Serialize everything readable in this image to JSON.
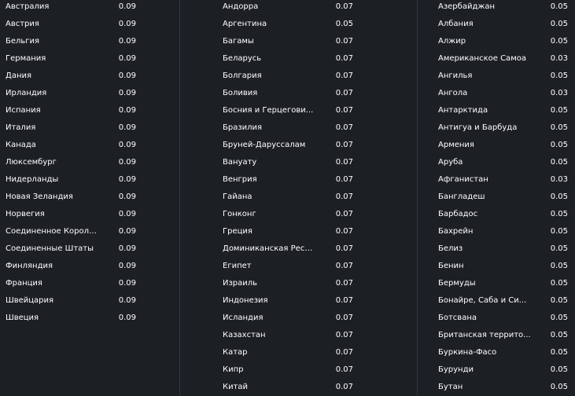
{
  "columns": [
    {
      "rows": [
        {
          "name": "Австралия",
          "value": "0.09"
        },
        {
          "name": "Австрия",
          "value": "0.09"
        },
        {
          "name": "Бельгия",
          "value": "0.09"
        },
        {
          "name": "Германия",
          "value": "0.09"
        },
        {
          "name": "Дания",
          "value": "0.09"
        },
        {
          "name": "Ирландия",
          "value": "0.09"
        },
        {
          "name": "Испания",
          "value": "0.09"
        },
        {
          "name": "Италия",
          "value": "0.09"
        },
        {
          "name": "Канада",
          "value": "0.09"
        },
        {
          "name": "Люксембург",
          "value": "0.09"
        },
        {
          "name": "Нидерланды",
          "value": "0.09"
        },
        {
          "name": "Новая Зеландия",
          "value": "0.09"
        },
        {
          "name": "Норвегия",
          "value": "0.09"
        },
        {
          "name": "Соединенное Короле...",
          "value": "0.09"
        },
        {
          "name": "Соединенные Штаты",
          "value": "0.09"
        },
        {
          "name": "Финляндия",
          "value": "0.09"
        },
        {
          "name": "Франция",
          "value": "0.09"
        },
        {
          "name": "Швейцария",
          "value": "0.09"
        },
        {
          "name": "Швеция",
          "value": "0.09"
        }
      ]
    },
    {
      "rows": [
        {
          "name": "Андорра",
          "value": "0.07"
        },
        {
          "name": "Аргентина",
          "value": "0.05"
        },
        {
          "name": "Багамы",
          "value": "0.07"
        },
        {
          "name": "Беларусь",
          "value": "0.07"
        },
        {
          "name": "Болгария",
          "value": "0.07"
        },
        {
          "name": "Боливия",
          "value": "0.07"
        },
        {
          "name": "Босния и Герцегови...",
          "value": "0.07"
        },
        {
          "name": "Бразилия",
          "value": "0.07"
        },
        {
          "name": "Бруней-Даруссалам",
          "value": "0.07"
        },
        {
          "name": "Вануату",
          "value": "0.07"
        },
        {
          "name": "Венгрия",
          "value": "0.07"
        },
        {
          "name": "Гайана",
          "value": "0.07"
        },
        {
          "name": "Гонконг",
          "value": "0.07"
        },
        {
          "name": "Греция",
          "value": "0.07"
        },
        {
          "name": "Доминиканская Респ...",
          "value": "0.07"
        },
        {
          "name": "Египет",
          "value": "0.07"
        },
        {
          "name": "Израиль",
          "value": "0.07"
        },
        {
          "name": "Индонезия",
          "value": "0.07"
        },
        {
          "name": "Исландия",
          "value": "0.07"
        },
        {
          "name": "Казахстан",
          "value": "0.07"
        },
        {
          "name": "Катар",
          "value": "0.07"
        },
        {
          "name": "Кипр",
          "value": "0.07"
        },
        {
          "name": "Китай",
          "value": "0.07"
        }
      ]
    },
    {
      "rows": [
        {
          "name": "Азербайджан",
          "value": "0.05"
        },
        {
          "name": "Албания",
          "value": "0.05"
        },
        {
          "name": "Алжир",
          "value": "0.05"
        },
        {
          "name": "Американское Самоа",
          "value": "0.03"
        },
        {
          "name": "Ангилья",
          "value": "0.05"
        },
        {
          "name": "Ангола",
          "value": "0.03"
        },
        {
          "name": "Антарктида",
          "value": "0.05"
        },
        {
          "name": "Антигуа и Барбуда",
          "value": "0.05"
        },
        {
          "name": "Армения",
          "value": "0.05"
        },
        {
          "name": "Аруба",
          "value": "0.05"
        },
        {
          "name": "Афганистан",
          "value": "0.03"
        },
        {
          "name": "Бангладеш",
          "value": "0.05"
        },
        {
          "name": "Барбадос",
          "value": "0.05"
        },
        {
          "name": "Бахрейн",
          "value": "0.05"
        },
        {
          "name": "Белиз",
          "value": "0.05"
        },
        {
          "name": "Бенин",
          "value": "0.05"
        },
        {
          "name": "Бермуды",
          "value": "0.05"
        },
        {
          "name": "Бонайре, Саба и Си...",
          "value": "0.05"
        },
        {
          "name": "Ботсвана",
          "value": "0.05"
        },
        {
          "name": "Британская террито...",
          "value": "0.05"
        },
        {
          "name": "Буркина-Фасо",
          "value": "0.05"
        },
        {
          "name": "Бурунди",
          "value": "0.05"
        },
        {
          "name": "Бутан",
          "value": "0.05"
        }
      ]
    }
  ]
}
